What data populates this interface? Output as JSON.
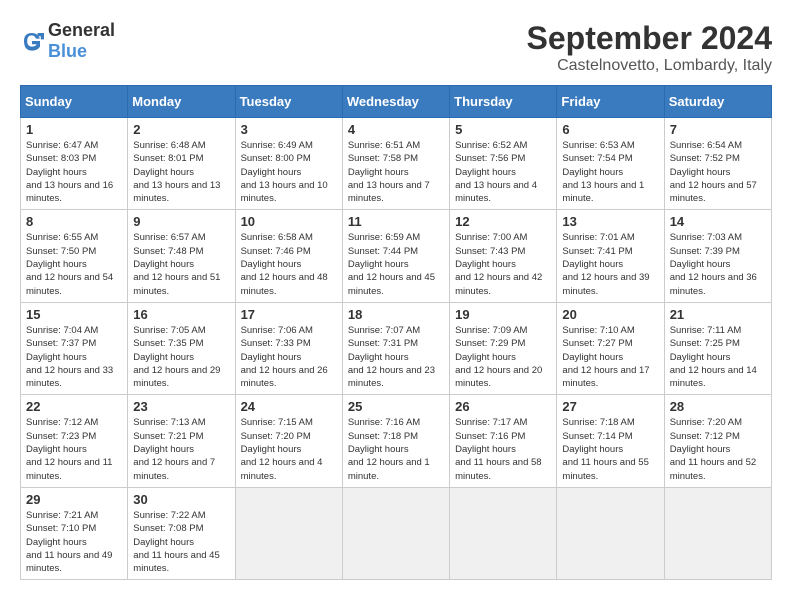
{
  "header": {
    "logo_general": "General",
    "logo_blue": "Blue",
    "month_title": "September 2024",
    "location": "Castelnovetto, Lombardy, Italy"
  },
  "weekdays": [
    "Sunday",
    "Monday",
    "Tuesday",
    "Wednesday",
    "Thursday",
    "Friday",
    "Saturday"
  ],
  "days": [
    {
      "day": "",
      "empty": true
    },
    {
      "day": "1",
      "sunrise": "6:47 AM",
      "sunset": "8:03 PM",
      "daylight": "13 hours and 16 minutes."
    },
    {
      "day": "2",
      "sunrise": "6:48 AM",
      "sunset": "8:01 PM",
      "daylight": "13 hours and 13 minutes."
    },
    {
      "day": "3",
      "sunrise": "6:49 AM",
      "sunset": "8:00 PM",
      "daylight": "13 hours and 10 minutes."
    },
    {
      "day": "4",
      "sunrise": "6:51 AM",
      "sunset": "7:58 PM",
      "daylight": "13 hours and 7 minutes."
    },
    {
      "day": "5",
      "sunrise": "6:52 AM",
      "sunset": "7:56 PM",
      "daylight": "13 hours and 4 minutes."
    },
    {
      "day": "6",
      "sunrise": "6:53 AM",
      "sunset": "7:54 PM",
      "daylight": "13 hours and 1 minute."
    },
    {
      "day": "7",
      "sunrise": "6:54 AM",
      "sunset": "7:52 PM",
      "daylight": "12 hours and 57 minutes."
    },
    {
      "day": "8",
      "sunrise": "6:55 AM",
      "sunset": "7:50 PM",
      "daylight": "12 hours and 54 minutes."
    },
    {
      "day": "9",
      "sunrise": "6:57 AM",
      "sunset": "7:48 PM",
      "daylight": "12 hours and 51 minutes."
    },
    {
      "day": "10",
      "sunrise": "6:58 AM",
      "sunset": "7:46 PM",
      "daylight": "12 hours and 48 minutes."
    },
    {
      "day": "11",
      "sunrise": "6:59 AM",
      "sunset": "7:44 PM",
      "daylight": "12 hours and 45 minutes."
    },
    {
      "day": "12",
      "sunrise": "7:00 AM",
      "sunset": "7:43 PM",
      "daylight": "12 hours and 42 minutes."
    },
    {
      "day": "13",
      "sunrise": "7:01 AM",
      "sunset": "7:41 PM",
      "daylight": "12 hours and 39 minutes."
    },
    {
      "day": "14",
      "sunrise": "7:03 AM",
      "sunset": "7:39 PM",
      "daylight": "12 hours and 36 minutes."
    },
    {
      "day": "15",
      "sunrise": "7:04 AM",
      "sunset": "7:37 PM",
      "daylight": "12 hours and 33 minutes."
    },
    {
      "day": "16",
      "sunrise": "7:05 AM",
      "sunset": "7:35 PM",
      "daylight": "12 hours and 29 minutes."
    },
    {
      "day": "17",
      "sunrise": "7:06 AM",
      "sunset": "7:33 PM",
      "daylight": "12 hours and 26 minutes."
    },
    {
      "day": "18",
      "sunrise": "7:07 AM",
      "sunset": "7:31 PM",
      "daylight": "12 hours and 23 minutes."
    },
    {
      "day": "19",
      "sunrise": "7:09 AM",
      "sunset": "7:29 PM",
      "daylight": "12 hours and 20 minutes."
    },
    {
      "day": "20",
      "sunrise": "7:10 AM",
      "sunset": "7:27 PM",
      "daylight": "12 hours and 17 minutes."
    },
    {
      "day": "21",
      "sunrise": "7:11 AM",
      "sunset": "7:25 PM",
      "daylight": "12 hours and 14 minutes."
    },
    {
      "day": "22",
      "sunrise": "7:12 AM",
      "sunset": "7:23 PM",
      "daylight": "12 hours and 11 minutes."
    },
    {
      "day": "23",
      "sunrise": "7:13 AM",
      "sunset": "7:21 PM",
      "daylight": "12 hours and 7 minutes."
    },
    {
      "day": "24",
      "sunrise": "7:15 AM",
      "sunset": "7:20 PM",
      "daylight": "12 hours and 4 minutes."
    },
    {
      "day": "25",
      "sunrise": "7:16 AM",
      "sunset": "7:18 PM",
      "daylight": "12 hours and 1 minute."
    },
    {
      "day": "26",
      "sunrise": "7:17 AM",
      "sunset": "7:16 PM",
      "daylight": "11 hours and 58 minutes."
    },
    {
      "day": "27",
      "sunrise": "7:18 AM",
      "sunset": "7:14 PM",
      "daylight": "11 hours and 55 minutes."
    },
    {
      "day": "28",
      "sunrise": "7:20 AM",
      "sunset": "7:12 PM",
      "daylight": "11 hours and 52 minutes."
    },
    {
      "day": "29",
      "sunrise": "7:21 AM",
      "sunset": "7:10 PM",
      "daylight": "11 hours and 49 minutes."
    },
    {
      "day": "30",
      "sunrise": "7:22 AM",
      "sunset": "7:08 PM",
      "daylight": "11 hours and 45 minutes."
    },
    {
      "day": "",
      "empty": true
    },
    {
      "day": "",
      "empty": true
    },
    {
      "day": "",
      "empty": true
    },
    {
      "day": "",
      "empty": true
    },
    {
      "day": "",
      "empty": true
    }
  ]
}
